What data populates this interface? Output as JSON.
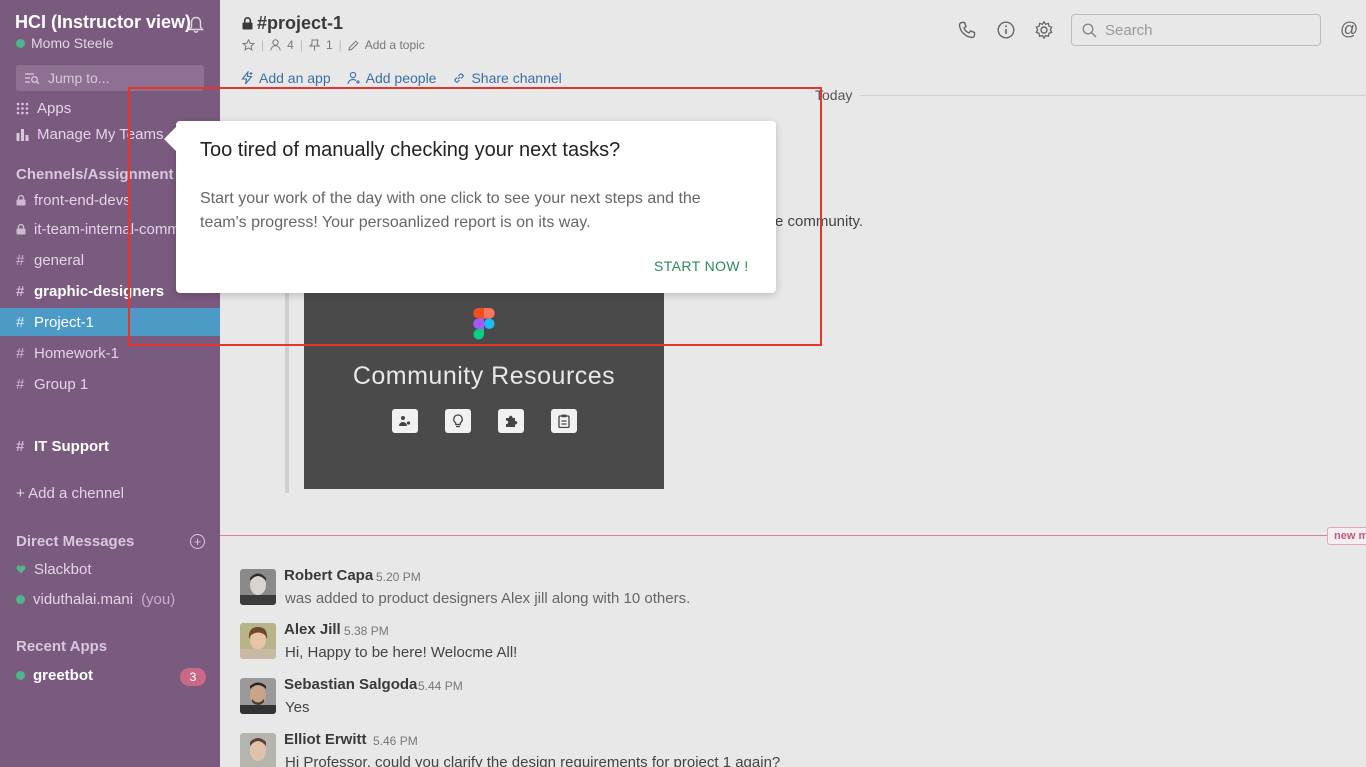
{
  "workspace": {
    "title": "HCI (Instructor view)",
    "user": "Momo Steele"
  },
  "sidebar": {
    "jump_placeholder": "Jump to...",
    "apps_label": "Apps",
    "manage_label": "Manage My Teams",
    "channels_heading": "Chennels/Assignment",
    "channels": [
      {
        "prefix": "lock",
        "name": "front-end-devs"
      },
      {
        "prefix": "lock",
        "name": "it-team-internal-comm"
      },
      {
        "prefix": "#",
        "name": "general"
      },
      {
        "prefix": "#",
        "name": "graphic-designers"
      },
      {
        "prefix": "#",
        "name": "Project-1"
      },
      {
        "prefix": "#",
        "name": "Homework-1"
      },
      {
        "prefix": "#",
        "name": "Group 1"
      },
      {
        "prefix": "#",
        "name": "IT Support"
      }
    ],
    "hash": "#",
    "add_channel": "+ Add a chennel",
    "dm_heading": "Direct Messages",
    "dms": [
      {
        "name": "Slackbot"
      },
      {
        "name": "viduthalai.mani",
        "suffix": "(you)"
      }
    ],
    "recent_heading": "Recent Apps",
    "recent_app": {
      "name": "greetbot",
      "badge": "3"
    }
  },
  "header": {
    "channel": "#project-1",
    "members": "4",
    "pins": "1",
    "topic": "Add a topic",
    "search_placeholder": "Search",
    "at": "@"
  },
  "actions": {
    "add_app": "Add an app",
    "add_people": "Add people",
    "share": "Share channel"
  },
  "feed": {
    "today": "Today",
    "bg_text": "e community.",
    "attachment_title": "Community Resources",
    "new_tag": "new m",
    "messages": [
      {
        "name": "Robert Capa",
        "time": "5.20 PM",
        "text": "was added to product designers Alex jill along with 10 others."
      },
      {
        "name": "Alex Jill",
        "time": "5.38 PM",
        "text": "Hi, Happy to be here! Welocme All!"
      },
      {
        "name": "Sebastian Salgoda",
        "time": "5.44 PM",
        "text": "Yes"
      },
      {
        "name": "Elliot Erwitt",
        "time": "5.46 PM",
        "text": "Hi Professor, could you clarify the design requirements for project 1 again?"
      }
    ]
  },
  "popup": {
    "title": "Too tired of manually checking your next tasks?",
    "body": "Start your work of the day with one click to see your next steps and the team's progress! Your persoanlized report is on its way.",
    "cta": "START NOW !"
  },
  "colors": {
    "sidebar_bg": "#7a5a7f",
    "active_channel": "#4c9bc7",
    "cta_green": "#2a8a57",
    "highlight_red": "#e5352c",
    "online": "#4fb58a"
  }
}
